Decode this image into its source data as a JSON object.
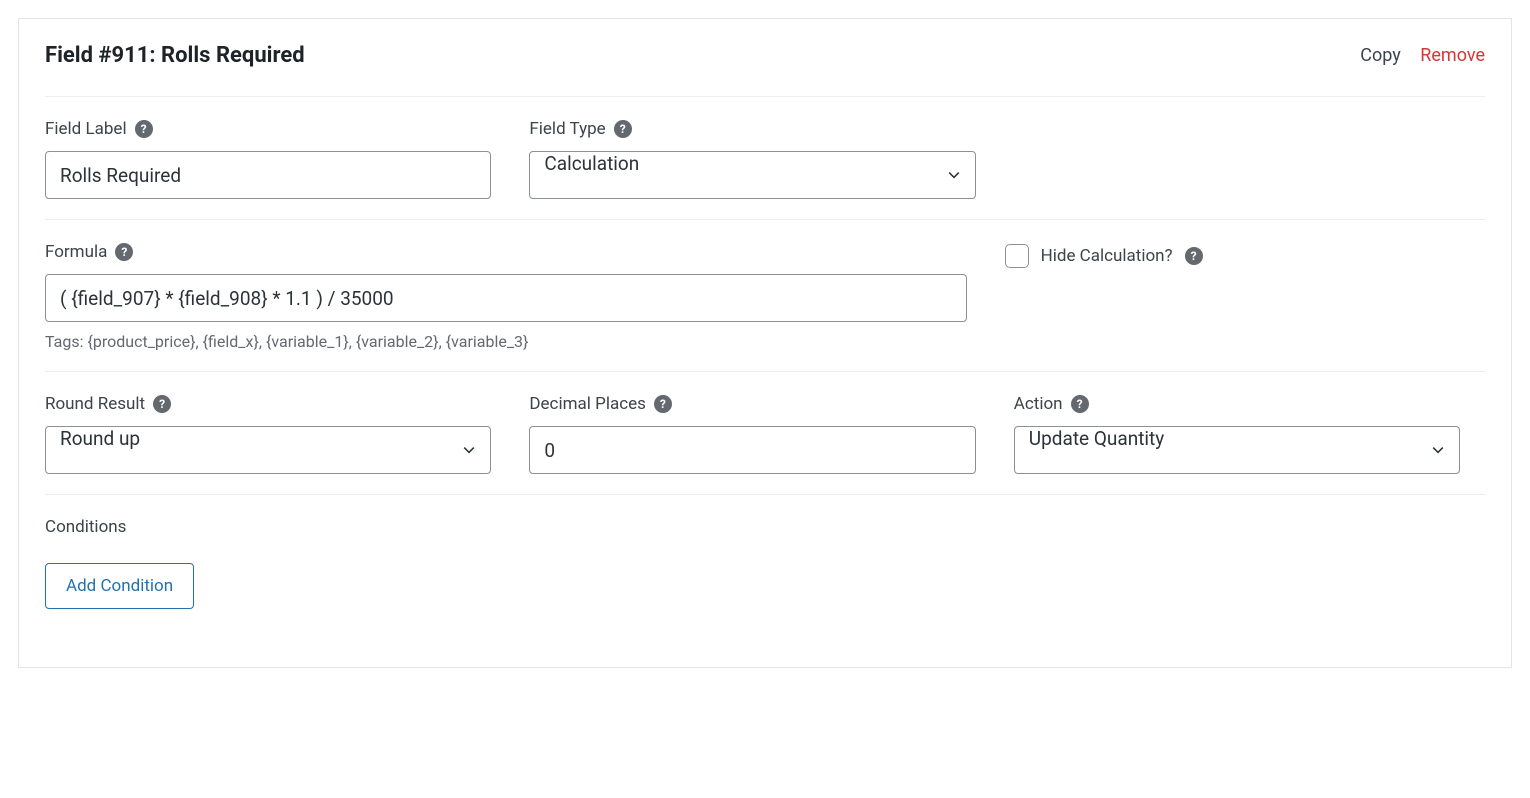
{
  "header": {
    "title": "Field #911: Rolls Required",
    "copy": "Copy",
    "remove": "Remove"
  },
  "labels": {
    "field_label": "Field Label",
    "field_type": "Field Type",
    "formula": "Formula",
    "hide_calculation": "Hide Calculation?",
    "round_result": "Round Result",
    "decimal_places": "Decimal Places",
    "action": "Action",
    "conditions": "Conditions",
    "add_condition": "Add Condition"
  },
  "values": {
    "field_label": "Rolls Required",
    "field_type": "Calculation",
    "formula": "( {field_907} * {field_908} * 1.1 ) / 35000",
    "tags_help": "Tags: {product_price}, {field_x}, {variable_1}, {variable_2}, {variable_3}",
    "hide_calculation": false,
    "round_result": "Round up",
    "decimal_places": "0",
    "action": "Update Quantity"
  }
}
